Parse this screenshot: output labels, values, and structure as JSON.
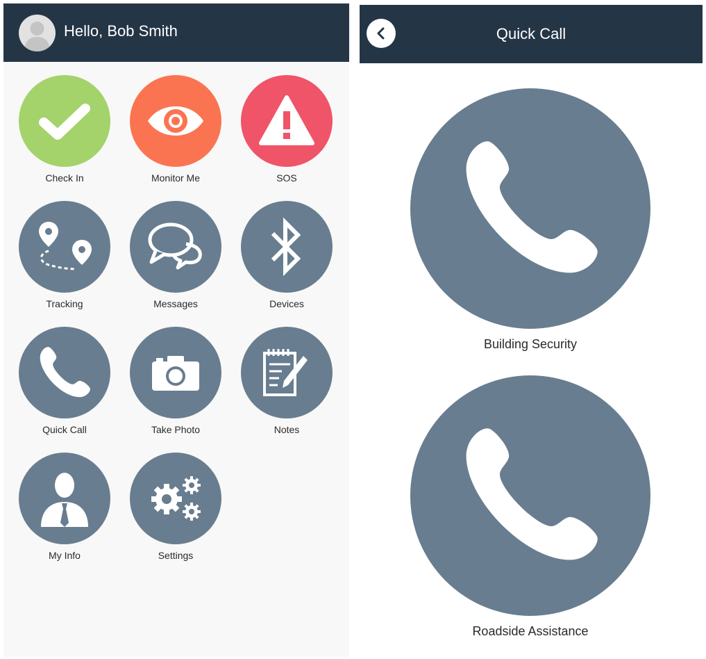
{
  "home": {
    "greeting": "Hello, Bob Smith",
    "tiles": [
      {
        "label": "Check In",
        "icon": "check-icon",
        "color": "#a3d36a"
      },
      {
        "label": "Monitor Me",
        "icon": "eye-icon",
        "color": "#fb7452"
      },
      {
        "label": "SOS",
        "icon": "warning-icon",
        "color": "#ef5468"
      },
      {
        "label": "Tracking",
        "icon": "route-pins-icon",
        "color": "#687d8f"
      },
      {
        "label": "Messages",
        "icon": "chat-bubbles-icon",
        "color": "#687d8f"
      },
      {
        "label": "Devices",
        "icon": "bluetooth-icon",
        "color": "#687d8f"
      },
      {
        "label": "Quick Call",
        "icon": "phone-icon",
        "color": "#687d8f"
      },
      {
        "label": "Take Photo",
        "icon": "camera-icon",
        "color": "#687d8f"
      },
      {
        "label": "Notes",
        "icon": "notepad-pencil-icon",
        "color": "#687d8f"
      },
      {
        "label": "My Info",
        "icon": "person-tie-icon",
        "color": "#687d8f"
      },
      {
        "label": "Settings",
        "icon": "gears-icon",
        "color": "#687d8f"
      }
    ]
  },
  "quick_call": {
    "title": "Quick Call",
    "back_icon": "chevron-left-icon",
    "contacts": [
      {
        "label": "Building Security",
        "icon": "phone-icon"
      },
      {
        "label": "Roadside Assistance",
        "icon": "phone-icon"
      }
    ]
  },
  "colors": {
    "header": "#243546",
    "tile_default": "#687d8f",
    "check_in": "#a3d36a",
    "monitor_me": "#fb7452",
    "sos": "#ef5468"
  }
}
